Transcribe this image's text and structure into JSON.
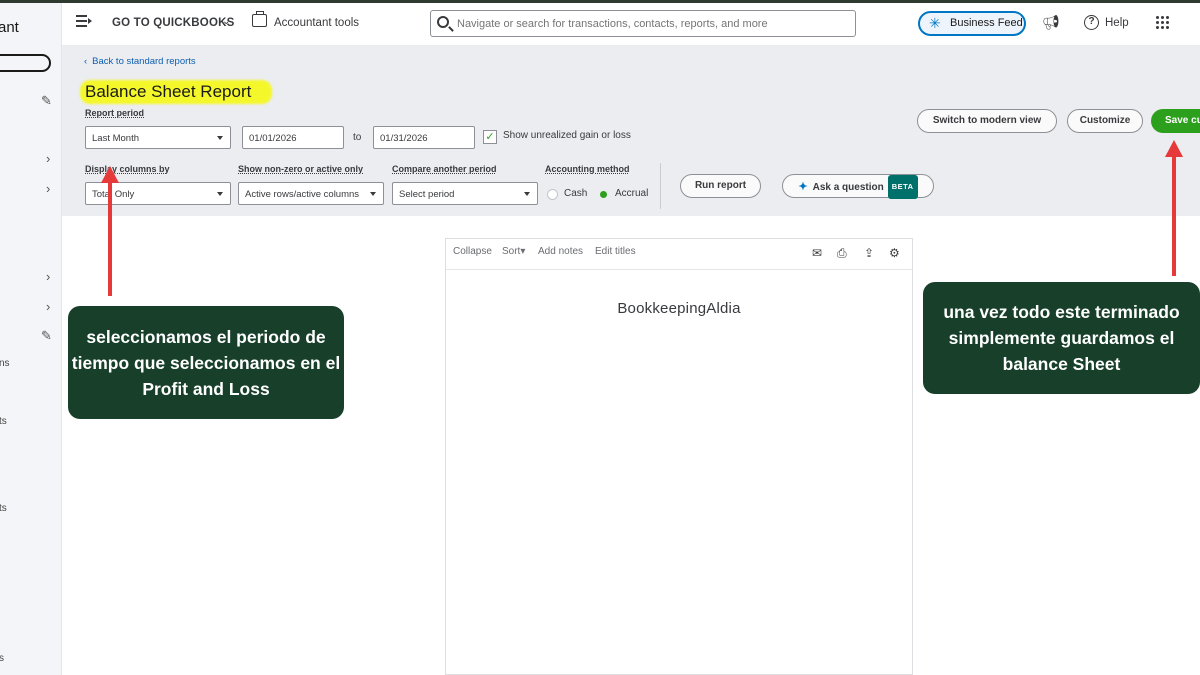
{
  "sidebar": {
    "brand_fragment": "ant",
    "text_fragments": [
      "ns",
      "ts",
      "ts",
      "s"
    ]
  },
  "topnav": {
    "go_to_quickbooks": "GO TO QUICKBOOKS",
    "accountant_tools": "Accountant tools",
    "search_placeholder": "Navigate or search for transactions, contacts, reports, and more",
    "business_feed": "Business Feed",
    "help": "Help"
  },
  "report_header": {
    "back_link": "Back to standard reports",
    "title": "Balance Sheet Report",
    "report_period_label": "Report period",
    "report_period_value": "Last Month",
    "date_from": "01/01/2026",
    "to_label": "to",
    "date_to": "01/31/2026",
    "unrealized_label": "Show unrealized gain or loss",
    "display_columns_label": "Display columns by",
    "display_columns_value": "Total Only",
    "nonzero_label": "Show non-zero or active only",
    "nonzero_value": "Active rows/active columns",
    "compare_label": "Compare another period",
    "compare_value": "Select period",
    "accounting_method_label": "Accounting method",
    "method_cash": "Cash",
    "method_accrual": "Accrual",
    "selected_method": "Accrual",
    "switch_view": "Switch to modern view",
    "customize": "Customize",
    "save": "Save cu",
    "run_report": "Run report",
    "ask_question": "Ask a question",
    "beta": "BETA"
  },
  "report_body": {
    "toolbar": {
      "collapse": "Collapse",
      "sort": "Sort",
      "add_notes": "Add notes",
      "edit_titles": "Edit titles"
    },
    "company_name": "BookkeepingAldia"
  },
  "annotations": {
    "left_callout": "seleccionamos el periodo de tiempo que seleccionamos en el Profit and Loss",
    "right_callout": "una vez todo este terminado simplemente guardamos el balance Sheet"
  },
  "colors": {
    "accent_green": "#2ca01c",
    "link_blue": "#0d5fb0",
    "callout_bg": "#173f2a",
    "arrow_red": "#e63a3a",
    "highlight_yellow": "#f4f72a"
  }
}
